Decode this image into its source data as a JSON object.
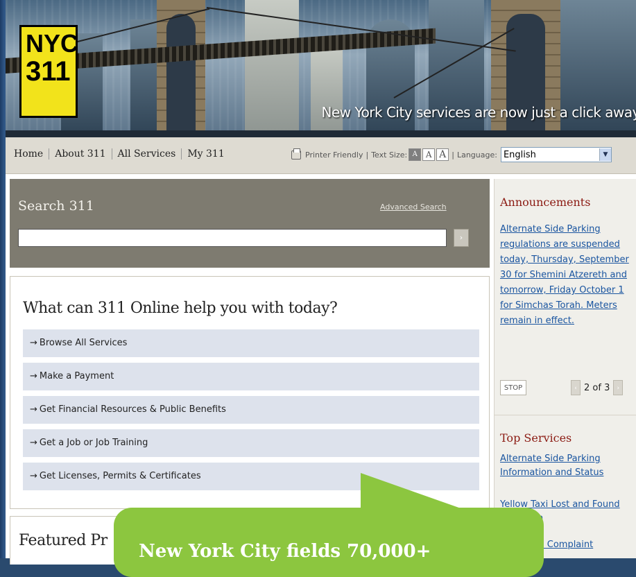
{
  "banner": {
    "logo_line1": "NYC",
    "logo_line2": "311",
    "tagline": "New York City services are now just a click away"
  },
  "nav": {
    "home": "Home",
    "about": "About 311",
    "all_services": "All Services",
    "my311": "My 311"
  },
  "tools": {
    "printer_friendly": "Printer Friendly",
    "sep": "|",
    "text_size_label": "Text Size:",
    "text_size_small": "A",
    "text_size_medium": "A",
    "text_size_large": "A",
    "language_label": "Language:",
    "language_value": "English"
  },
  "search": {
    "title": "Search 311",
    "advanced_link": "Advanced Search",
    "placeholder": "",
    "go": "›"
  },
  "help": {
    "title": "What can 311 Online help you with today?",
    "items": [
      "Browse All Services",
      "Make a Payment",
      "Get Financial Resources & Public Benefits",
      "Get a Job or Job Training",
      "Get Licenses, Permits & Certificates"
    ],
    "arrow": "→"
  },
  "featured": {
    "title": "Featured Pr"
  },
  "announcements": {
    "title": "Announcements",
    "text": "Alternate Side Parking regulations are suspended today, Thursday, September 30 for Shemini Atzereth and tomorrow, Friday October 1 for Simchas Torah. Meters remain in effect.",
    "stop": "STOP",
    "pager": "2 of 3",
    "prev": "‹",
    "next": "›"
  },
  "top_services": {
    "title": "Top Services",
    "links": [
      "Alternate Side Parking Information and Status",
      "Yellow Taxi Lost and Found",
      "n",
      "i Complaint"
    ],
    "link1_partial": "Yellow Taxi Lost and Found"
  },
  "callout": {
    "text": "New York City fields 70,000+"
  },
  "colors": {
    "logo_yellow": "#f2e31b",
    "callout_green": "#8cc63f",
    "link_blue": "#1a55a0",
    "heading_red": "#8b1a12"
  }
}
